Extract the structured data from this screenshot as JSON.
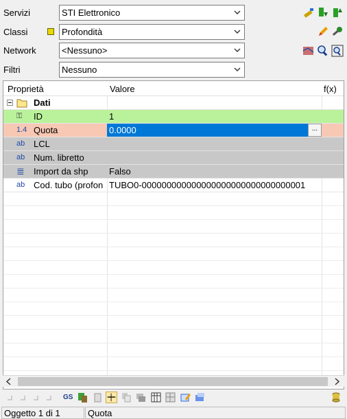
{
  "filters": {
    "servizi": {
      "label": "Servizi",
      "value": "STI Elettronico"
    },
    "classi": {
      "label": "Classi",
      "value": "Profondità"
    },
    "network": {
      "label": "Network",
      "value": "<Nessuno>"
    },
    "filtri": {
      "label": "Filtri",
      "value": "Nessuno"
    }
  },
  "grid": {
    "headers": {
      "property": "Proprietà",
      "value": "Valore",
      "fx": "f(x)"
    },
    "group": {
      "label": "Dati"
    },
    "rows": [
      {
        "icon": "key-icon",
        "glyph": "⚿",
        "name": "ID",
        "value": "1"
      },
      {
        "icon": "decimal-icon",
        "glyph": "1.4",
        "name": "Quota",
        "value": "0.0000"
      },
      {
        "icon": "text-icon",
        "glyph": "ab",
        "name": "LCL",
        "value": ""
      },
      {
        "icon": "text-icon",
        "glyph": "ab",
        "name": "Num. libretto",
        "value": ""
      },
      {
        "icon": "list-icon",
        "glyph": "≣",
        "name": "Import da shp",
        "value": "Falso"
      },
      {
        "icon": "text-icon",
        "glyph": "ab",
        "name": "Cod. tubo (profon",
        "value": "TUBO0-000000000000000000000000000000001"
      }
    ],
    "ellipsis": "..."
  },
  "bottom_toolbar": {
    "gs_label": "GS"
  },
  "status": {
    "object": "Oggetto 1 di 1",
    "field": "Quota"
  },
  "colors": {
    "id_row": "#b9f29b",
    "quota_row": "#f7c8b4",
    "gray_row": "#c8c8c8",
    "selection": "#0078d7"
  }
}
